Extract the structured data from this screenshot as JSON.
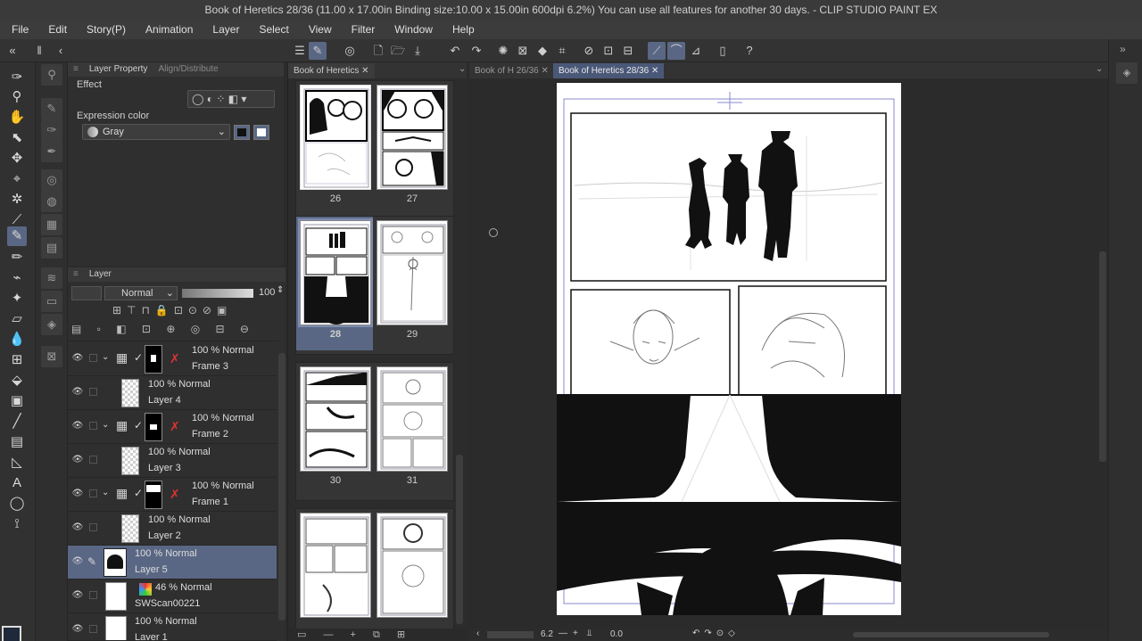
{
  "window": {
    "title": "Book of Heretics 28/36 (11.00 x 17.00in Binding size:10.00 x 15.00in 600dpi 6.2%)  You can use all features for another 30 days. - CLIP STUDIO PAINT EX"
  },
  "menu": [
    "File",
    "Edit",
    "Story(P)",
    "Animation",
    "Layer",
    "Select",
    "View",
    "Filter",
    "Window",
    "Help"
  ],
  "property_panel": {
    "tabs": [
      "Layer Property",
      "Align/Distribute"
    ],
    "effect_label": "Effect",
    "expression_color_label": "Expression color",
    "expression_color_value": "Gray"
  },
  "layer_panel": {
    "tab": "Layer",
    "blend_mode": "Normal",
    "opacity": "100",
    "layers": [
      {
        "opacity": "100 % Normal",
        "name": "Frame 3",
        "kind": "folder"
      },
      {
        "opacity": "100 % Normal",
        "name": "Layer 4",
        "kind": "raster"
      },
      {
        "opacity": "100 % Normal",
        "name": "Frame 2",
        "kind": "folder"
      },
      {
        "opacity": "100 % Normal",
        "name": "Layer 3",
        "kind": "raster"
      },
      {
        "opacity": "100 % Normal",
        "name": "Frame 1",
        "kind": "folder"
      },
      {
        "opacity": "100 % Normal",
        "name": "Layer 2",
        "kind": "raster"
      },
      {
        "opacity": "100 % Normal",
        "name": "Layer 5",
        "kind": "raster",
        "selected": true
      },
      {
        "opacity": "46 % Normal",
        "name": "SWScan00221",
        "kind": "raster"
      },
      {
        "opacity": "100 % Normal",
        "name": "Layer 1",
        "kind": "raster"
      }
    ]
  },
  "page_manager": {
    "tab": "Book of Heretics",
    "pages": [
      "26",
      "27",
      "28",
      "29",
      "30",
      "31"
    ]
  },
  "canvas": {
    "tabs": [
      "Book of H 26/36",
      "Book of Heretics 28/36"
    ],
    "zoom": "6.2",
    "angle": "0.0"
  },
  "colors": {
    "accent": "#5a6784",
    "panel": "#2f2f2f",
    "background": "#2b2b2b"
  }
}
